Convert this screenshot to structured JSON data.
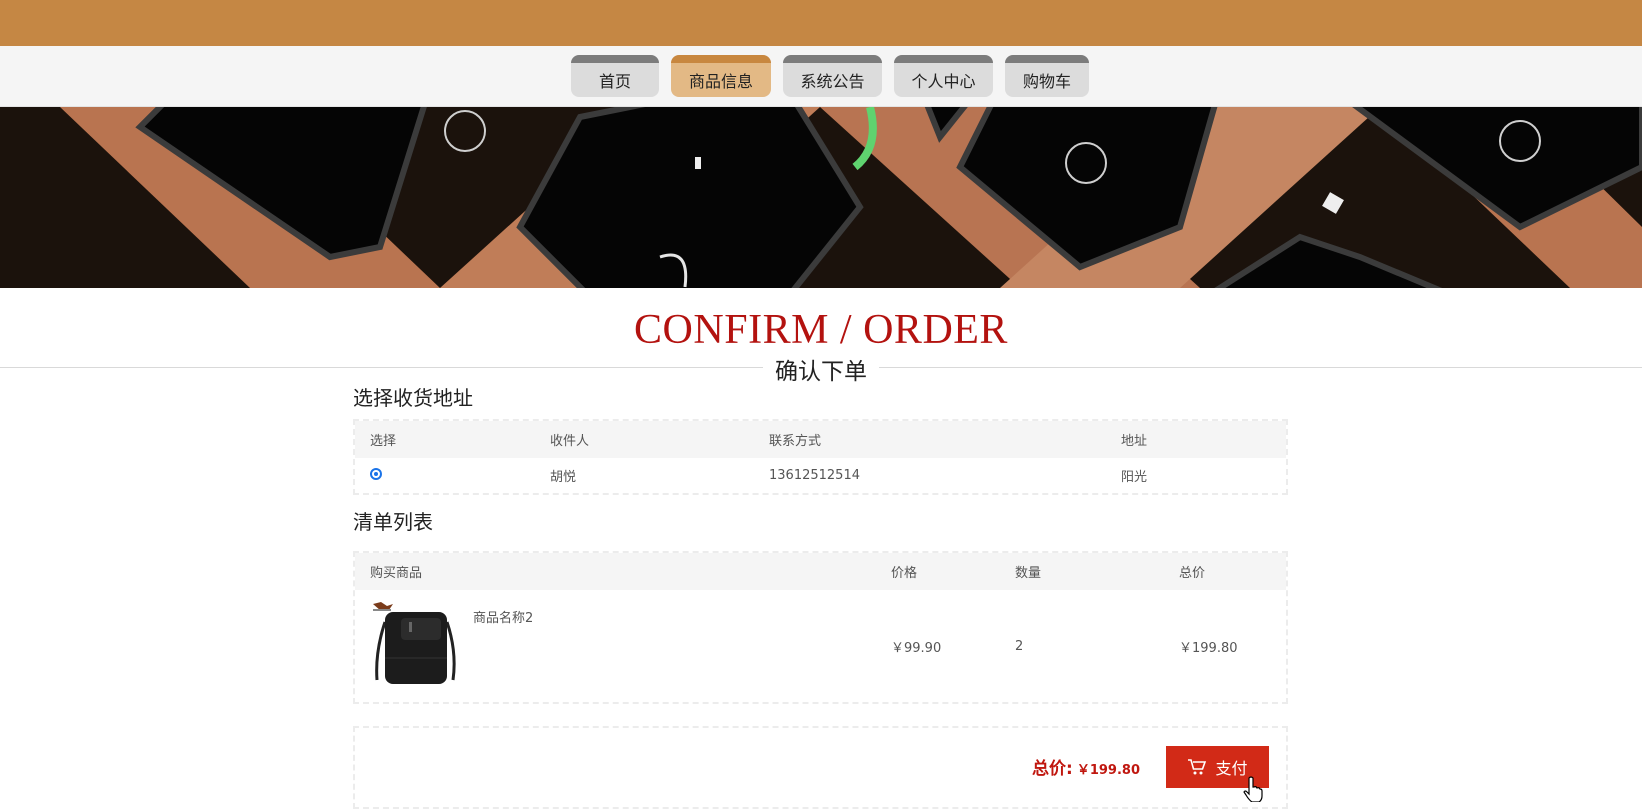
{
  "nav": {
    "items": [
      "首页",
      "商品信息",
      "系统公告",
      "个人中心",
      "购物车"
    ],
    "active_index": 1
  },
  "heading": {
    "en": "CONFIRM / ORDER",
    "cn": "确认下单"
  },
  "address": {
    "section_title": "选择收货地址",
    "columns": [
      "选择",
      "收件人",
      "联系方式",
      "地址"
    ],
    "rows": [
      {
        "selected": true,
        "recipient": "胡悦",
        "phone": "13612512514",
        "address": "阳光"
      }
    ]
  },
  "cart": {
    "section_title": "清单列表",
    "columns": [
      "购买商品",
      "价格",
      "数量",
      "总价"
    ],
    "items": [
      {
        "name": "商品名称2",
        "price": "￥99.90",
        "quantity": "2",
        "total": "￥199.80",
        "image": "black-shoulder-bag"
      }
    ]
  },
  "summary": {
    "total_label": "总价:",
    "total_value": "￥199.80",
    "pay_label": "支付"
  },
  "colors": {
    "topbar": "#c58744",
    "nav_active": "#e3b985",
    "accent_red": "#d22a17",
    "title_red": "#b3120f"
  }
}
